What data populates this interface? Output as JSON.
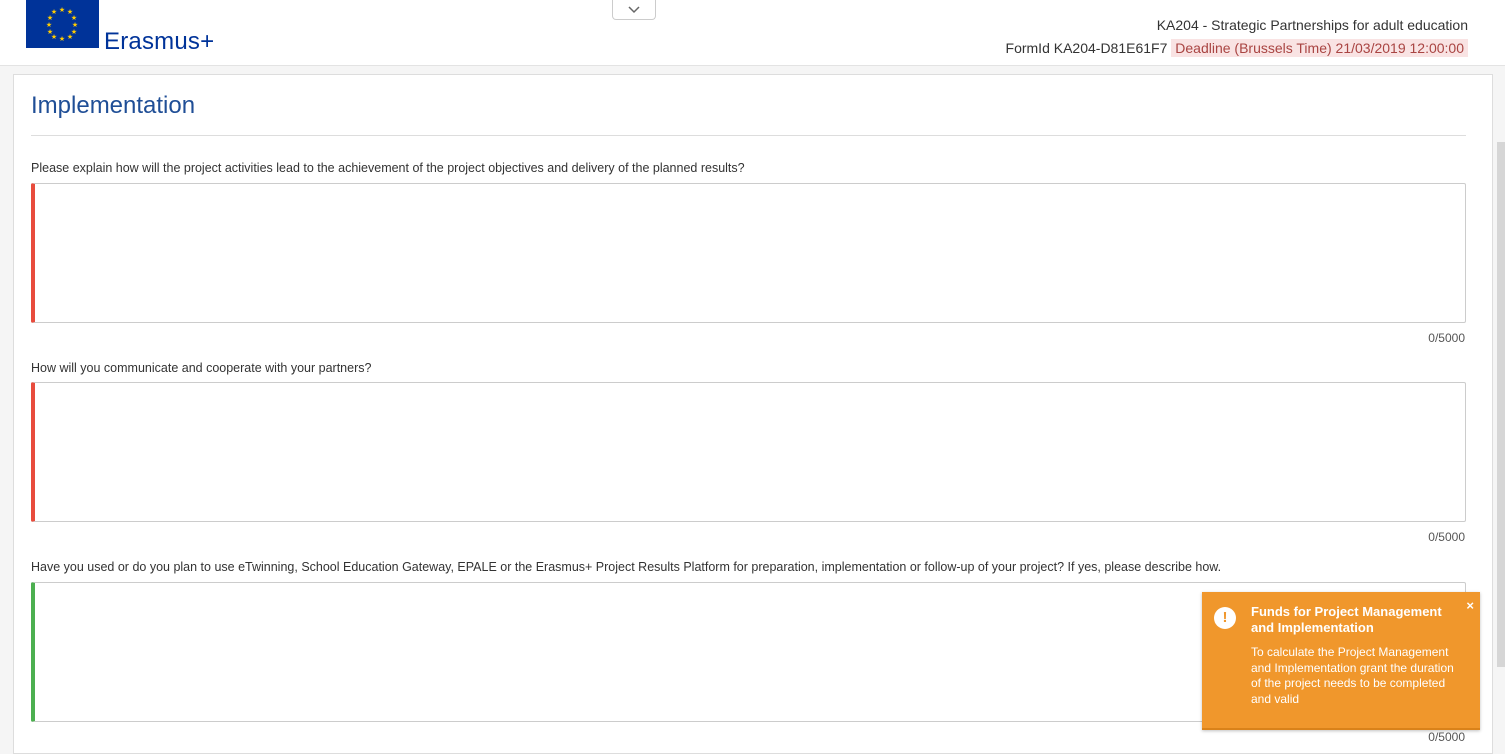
{
  "header": {
    "brand": "Erasmus+",
    "action_type": "KA204 - Strategic Partnerships for adult education",
    "form_id": "FormId KA204-D81E61F7",
    "deadline": "Deadline (Brussels Time) 21/03/2019 12:00:00",
    "icons": {
      "flag": "eu-flag-logo",
      "toggle": "chevron-down-icon"
    }
  },
  "section": {
    "title": "Implementation"
  },
  "questions": [
    {
      "label": "Please explain how will the project activities lead to the achievement of the project objectives and delivery of the planned results?",
      "value": "",
      "counter": "0/5000",
      "state": "invalid"
    },
    {
      "label": "How will you communicate and cooperate with your partners?",
      "value": "",
      "counter": "0/5000",
      "state": "invalid"
    },
    {
      "label": "Have you used or do you plan to use eTwinning, School Education Gateway, EPALE or the Erasmus+ Project Results Platform for preparation, implementation or follow-up of your project? If yes, please describe how.",
      "value": "",
      "counter": "0/5000",
      "state": "valid"
    }
  ],
  "toast": {
    "title": "Funds for Project Management and Implementation",
    "body": "To calculate the Project Management and Implementation grant the duration of the project needs to be completed and valid",
    "close": "×",
    "icon": "exclamation-icon"
  },
  "colors": {
    "brand_blue": "#003399",
    "title_blue": "#1f4e96",
    "invalid_border": "#e84c3d",
    "valid_border": "#4caf50",
    "toast_bg": "#f0972c",
    "deadline_bg": "#f9e3e3"
  }
}
